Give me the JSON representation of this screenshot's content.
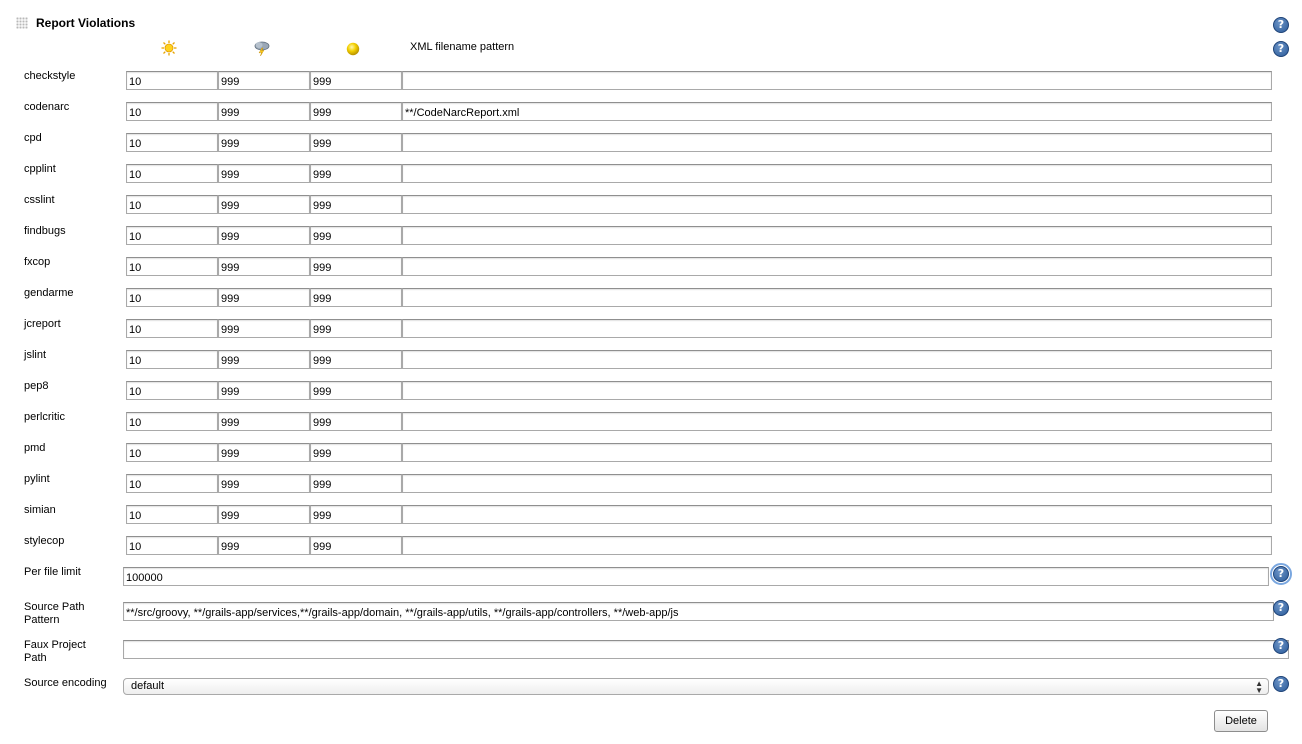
{
  "section": {
    "title": "Report Violations"
  },
  "columns": {
    "sunny_icon": "sunny-icon",
    "stormy_icon": "stormy-icon",
    "unstable_icon": "yellow-ball-icon",
    "pattern_header": "XML filename pattern"
  },
  "tools": [
    {
      "name": "checkstyle",
      "sunny": "10",
      "stormy": "999",
      "unstable": "999",
      "pattern": ""
    },
    {
      "name": "codenarc",
      "sunny": "10",
      "stormy": "999",
      "unstable": "999",
      "pattern": "**/CodeNarcReport.xml"
    },
    {
      "name": "cpd",
      "sunny": "10",
      "stormy": "999",
      "unstable": "999",
      "pattern": ""
    },
    {
      "name": "cpplint",
      "sunny": "10",
      "stormy": "999",
      "unstable": "999",
      "pattern": ""
    },
    {
      "name": "csslint",
      "sunny": "10",
      "stormy": "999",
      "unstable": "999",
      "pattern": ""
    },
    {
      "name": "findbugs",
      "sunny": "10",
      "stormy": "999",
      "unstable": "999",
      "pattern": ""
    },
    {
      "name": "fxcop",
      "sunny": "10",
      "stormy": "999",
      "unstable": "999",
      "pattern": ""
    },
    {
      "name": "gendarme",
      "sunny": "10",
      "stormy": "999",
      "unstable": "999",
      "pattern": ""
    },
    {
      "name": "jcreport",
      "sunny": "10",
      "stormy": "999",
      "unstable": "999",
      "pattern": ""
    },
    {
      "name": "jslint",
      "sunny": "10",
      "stormy": "999",
      "unstable": "999",
      "pattern": ""
    },
    {
      "name": "pep8",
      "sunny": "10",
      "stormy": "999",
      "unstable": "999",
      "pattern": ""
    },
    {
      "name": "perlcritic",
      "sunny": "10",
      "stormy": "999",
      "unstable": "999",
      "pattern": ""
    },
    {
      "name": "pmd",
      "sunny": "10",
      "stormy": "999",
      "unstable": "999",
      "pattern": ""
    },
    {
      "name": "pylint",
      "sunny": "10",
      "stormy": "999",
      "unstable": "999",
      "pattern": ""
    },
    {
      "name": "simian",
      "sunny": "10",
      "stormy": "999",
      "unstable": "999",
      "pattern": ""
    },
    {
      "name": "stylecop",
      "sunny": "10",
      "stormy": "999",
      "unstable": "999",
      "pattern": ""
    }
  ],
  "per_file_limit": {
    "label": "Per file limit",
    "value": "100000"
  },
  "source_path_pattern": {
    "label_line1": "Source Path",
    "label_line2": "Pattern",
    "value": "**/src/groovy, **/grails-app/services,**/grails-app/domain, **/grails-app/utils, **/grails-app/controllers, **/web-app/js"
  },
  "faux_project_path": {
    "label_line1": "Faux Project",
    "label_line2": "Path",
    "value": ""
  },
  "source_encoding": {
    "label": "Source encoding",
    "selected": "default",
    "arrows": "⌃⌄"
  },
  "help": {
    "glyph": "?"
  },
  "actions": {
    "delete_label": "Delete"
  }
}
